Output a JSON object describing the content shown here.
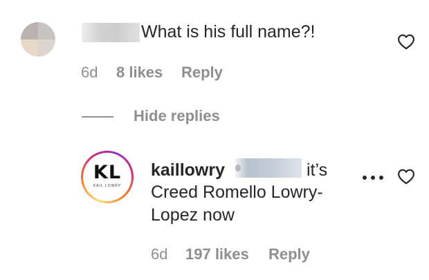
{
  "comment": {
    "text": "What is his full name?!",
    "time": "6d",
    "likes": "8 likes",
    "reply_label": "Reply"
  },
  "replies_toggle": {
    "label": "Hide replies"
  },
  "reply": {
    "avatar_logo": {
      "mark": "KL",
      "sub": "KAIL LOWRY"
    },
    "username": "kaillowry",
    "text_tail": "it’s",
    "text_line2": "Creed Romello Lowry-",
    "text_line3": "Lopez now",
    "time": "6d",
    "likes": "197 likes",
    "reply_label": "Reply"
  },
  "icons": {
    "like": "heart-outline-icon",
    "more": "more-horizontal-icon"
  },
  "colors": {
    "text": "#262626",
    "secondary": "#8e8e8e",
    "background": "#ffffff",
    "story_ring": [
      "#feda75",
      "#fa7e1e",
      "#d62976",
      "#962fbf"
    ]
  }
}
